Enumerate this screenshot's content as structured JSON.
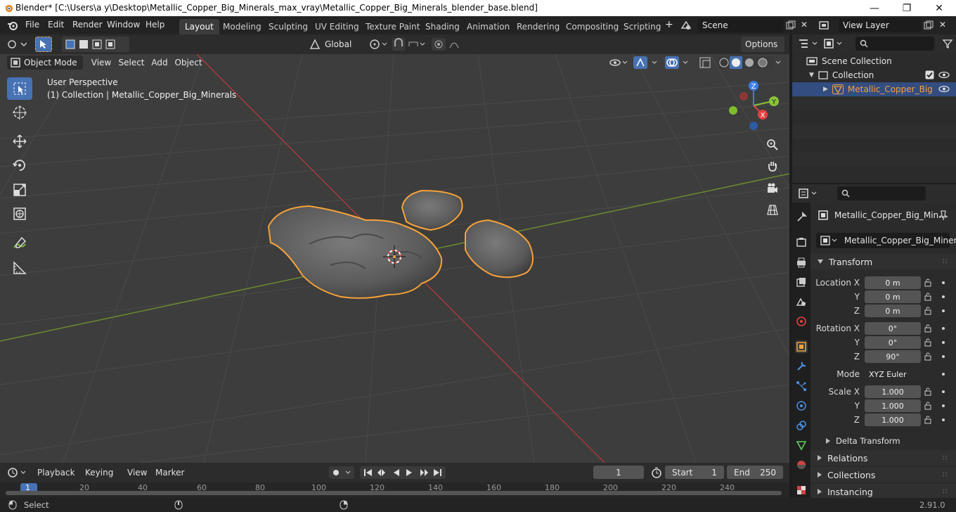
{
  "window": {
    "title": "Blender* [C:\\Users\\a y\\Desktop\\Metallic_Copper_Big_Minerals_max_vray\\Metallic_Copper_Big_Minerals_blender_base.blend]",
    "minimize": "—",
    "maximize": "❐",
    "close": "✕"
  },
  "menu": [
    "File",
    "Edit",
    "Render",
    "Window",
    "Help"
  ],
  "workspaces": [
    "Layout",
    "Modeling",
    "Sculpting",
    "UV Editing",
    "Texture Paint",
    "Shading",
    "Animation",
    "Rendering",
    "Compositing",
    "Scripting"
  ],
  "workspace_add": "+",
  "scene": {
    "name": "Scene",
    "view_layer": "View Layer"
  },
  "toolhdr": {
    "orientation": "Global",
    "options": "Options"
  },
  "viewport_header": {
    "mode": "Object Mode",
    "menus": [
      "View",
      "Select",
      "Add",
      "Object"
    ]
  },
  "viewport": {
    "perspective": "User Perspective",
    "collection_info": "(1) Collection | Metallic_Copper_Big_Minerals"
  },
  "gizmo": {
    "x": "X",
    "y": "Y",
    "z": "Z"
  },
  "outliner": {
    "scene_collection": "Scene Collection",
    "collection": "Collection",
    "object": "Metallic_Copper_Big"
  },
  "properties": {
    "object_name": "Metallic_Copper_Big_Min...",
    "data_name": "Metallic_Copper_Big_Minerals",
    "transform_title": "Transform",
    "location": {
      "label": "Location X",
      "x": "0 m",
      "y": "0 m",
      "z": "0 m"
    },
    "rotation": {
      "label": "Rotation X",
      "x": "0°",
      "y": "0°",
      "z": "90°"
    },
    "mode_label": "Mode",
    "mode_value": "XYZ Euler",
    "scale": {
      "label": "Scale X",
      "x": "1.000",
      "y": "1.000",
      "z": "1.000"
    },
    "axis_y": "Y",
    "axis_z": "Z",
    "delta": "Delta Transform",
    "relations": "Relations",
    "collections": "Collections",
    "instancing": "Instancing"
  },
  "timeline": {
    "menus": [
      "Playback",
      "Keying",
      "View",
      "Marker"
    ],
    "current_frame": "1",
    "start_label": "Start",
    "start": "1",
    "end_label": "End",
    "end": "250",
    "ruler": [
      "1",
      "20",
      "40",
      "60",
      "80",
      "100",
      "120",
      "140",
      "160",
      "180",
      "200",
      "220",
      "240"
    ]
  },
  "status": {
    "select": "Select",
    "version": "2.91.0"
  },
  "colors": {
    "accent": "#4772b3",
    "selection": "#f5a23a",
    "axis_x": "#e44141",
    "axis_y": "#8ac43a",
    "axis_z": "#3a7de4"
  }
}
